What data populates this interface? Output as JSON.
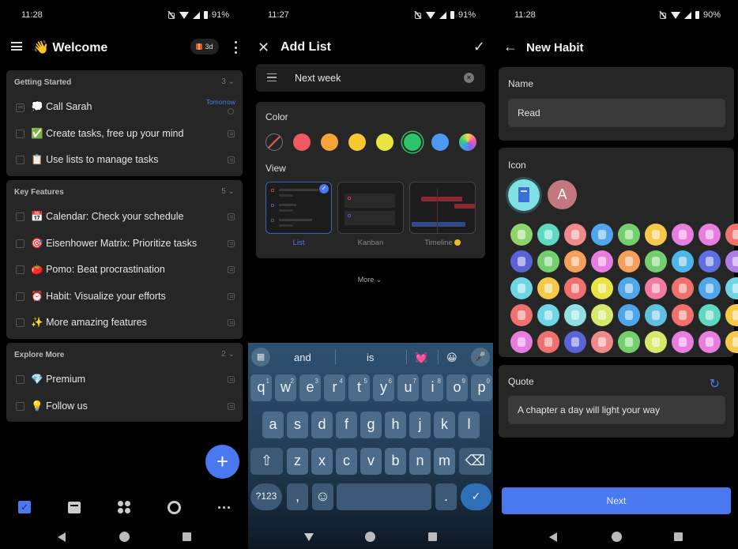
{
  "screens": [
    {
      "status": {
        "time": "11:28",
        "battery": "91%"
      },
      "header": {
        "emoji": "👋",
        "title": "Welcome",
        "badge": "3d"
      },
      "groups": [
        {
          "title": "Getting Started",
          "count": "3 ⌄",
          "tasks": [
            {
              "emoji": "💭",
              "text": "Call Sarah",
              "due": "Tomorrow"
            },
            {
              "emoji": "✅",
              "text": "Create tasks, free up your mind"
            },
            {
              "emoji": "📋",
              "text": "Use lists to manage tasks"
            }
          ]
        },
        {
          "title": "Key Features",
          "count": "5 ⌄",
          "tasks": [
            {
              "emoji": "📅",
              "text": "Calendar: Check your schedule"
            },
            {
              "emoji": "🎯",
              "text": "Eisenhower Matrix: Prioritize tasks"
            },
            {
              "emoji": "🍅",
              "text": "Pomo: Beat procrastination"
            },
            {
              "emoji": "⏰",
              "text": "Habit: Visualize your efforts"
            },
            {
              "emoji": "✨",
              "text": "More amazing features"
            }
          ]
        },
        {
          "title": "Explore More",
          "count": "2 ⌄",
          "tasks": [
            {
              "emoji": "💎",
              "text": "Premium"
            },
            {
              "emoji": "💡",
              "text": "Follow us"
            }
          ]
        }
      ],
      "fab": "+",
      "bottom_nav": [
        "tasks",
        "calendar",
        "matrix",
        "pomodoro",
        "more"
      ]
    },
    {
      "status": {
        "time": "11:27",
        "battery": "91%"
      },
      "header": {
        "close": "✕",
        "title": "Add List",
        "confirm": "✓"
      },
      "name_field": {
        "value": "Next week"
      },
      "color_label": "Color",
      "colors": [
        {
          "name": "none",
          "hex": "none"
        },
        {
          "name": "red",
          "hex": "#f05a5e"
        },
        {
          "name": "orange",
          "hex": "#f7a23b"
        },
        {
          "name": "yellow",
          "hex": "#f8c92e"
        },
        {
          "name": "lime",
          "hex": "#e8e443"
        },
        {
          "name": "green",
          "hex": "#2cc46b",
          "selected": true
        },
        {
          "name": "blue",
          "hex": "#4a9af2"
        },
        {
          "name": "rainbow",
          "hex": "gradient"
        }
      ],
      "view_label": "View",
      "views": [
        {
          "label": "List",
          "selected": true
        },
        {
          "label": "Kanban"
        },
        {
          "label": "Timeline",
          "premium": true
        }
      ],
      "more": "More ⌄",
      "keyboard": {
        "suggestions": [
          "and",
          "is",
          "💓",
          "😀"
        ],
        "row1": [
          "q",
          "w",
          "e",
          "r",
          "t",
          "y",
          "u",
          "i",
          "o",
          "p"
        ],
        "row1_nums": [
          "1",
          "2",
          "3",
          "4",
          "5",
          "6",
          "7",
          "8",
          "9",
          "0"
        ],
        "row2": [
          "a",
          "s",
          "d",
          "f",
          "g",
          "h",
          "j",
          "k",
          "l"
        ],
        "row3": [
          "z",
          "x",
          "c",
          "v",
          "b",
          "n",
          "m"
        ],
        "shift": "⇧",
        "backspace": "⌫",
        "symbols": "?123",
        "comma": ",",
        "emoji": "☺",
        "period": ".",
        "enter": "✓"
      }
    },
    {
      "status": {
        "time": "11:28",
        "battery": "90%"
      },
      "header": {
        "back": "←",
        "title": "New Habit"
      },
      "name_label": "Name",
      "name_value": "Read",
      "icon_label": "Icon",
      "custom_letter": "A",
      "icon_colors": [
        [
          "#8fd46a",
          "#5fd9c2",
          "#f08a8a",
          "#4fa6ea",
          "#74cf6e",
          "#f6c94a",
          "#e87de0",
          "#e87de0",
          "#f0706a"
        ],
        [
          "#5a64d8",
          "#74cf6e",
          "#f4a05a",
          "#e87de0",
          "#f4a05a",
          "#74cf6e",
          "#4fb6ea",
          "#6070e0",
          "#b07de8"
        ],
        [
          "#6fd6e6",
          "#f6c94a",
          "#f07070",
          "#e8e443",
          "#4fa6ea",
          "#f07aa0",
          "#f07070",
          "#4fa6ea",
          "#6fd6e6"
        ],
        [
          "#f07070",
          "#6fd6e6",
          "#8fe0e0",
          "#d8e86a",
          "#4fa6ea",
          "#5fc0e0",
          "#f07070",
          "#5fd9c2",
          "#f6c94a"
        ],
        [
          "#e87de0",
          "#f07070",
          "#5a64d8",
          "#f08a8a",
          "#74cf6e",
          "#d8e86a",
          "#e87de0",
          "#e87de0",
          "#f6c94a"
        ]
      ],
      "quote_label": "Quote",
      "quote_value": "A chapter a day will light your way",
      "next": "Next"
    }
  ]
}
